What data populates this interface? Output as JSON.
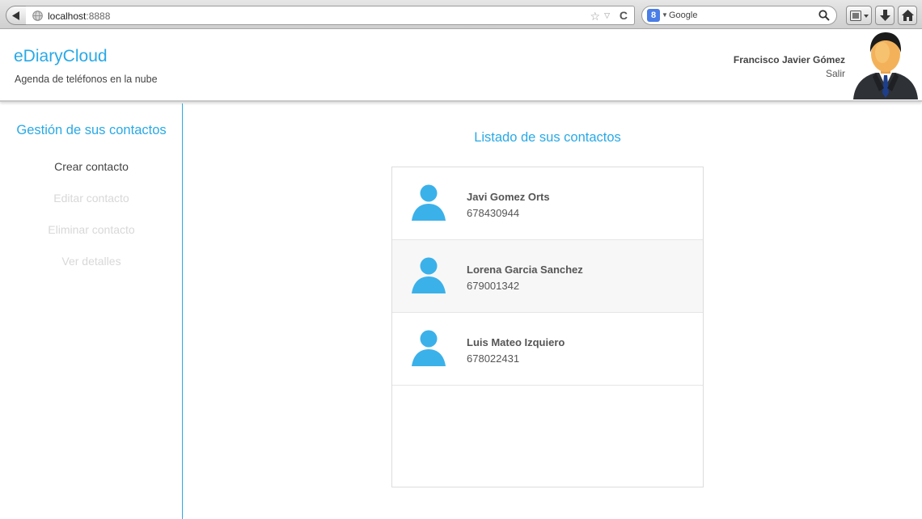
{
  "browser": {
    "url_host": "localhost",
    "url_port": ":8888",
    "search_engine": "Google",
    "search_badge": "8"
  },
  "header": {
    "title": "eDiaryCloud",
    "subtitle": "Agenda de teléfonos en la nube",
    "user_name": "Francisco Javier Gómez",
    "logout_label": "Salir"
  },
  "sidebar": {
    "title": "Gestión de sus contactos",
    "items": [
      {
        "label": "Crear contacto",
        "enabled": true
      },
      {
        "label": "Editar contacto",
        "enabled": false
      },
      {
        "label": "Eliminar contacto",
        "enabled": false
      },
      {
        "label": "Ver detalles",
        "enabled": false
      }
    ]
  },
  "main": {
    "title": "Listado de sus contactos",
    "contacts": [
      {
        "name": "Javi Gomez Orts",
        "phone": "678430944"
      },
      {
        "name": "Lorena Garcia Sanchez",
        "phone": "679001342"
      },
      {
        "name": "Luis Mateo Izquiero",
        "phone": "678022431"
      }
    ]
  },
  "colors": {
    "accent": "#29a9e6",
    "text": "#444444",
    "disabled_text": "#d8d8d8",
    "row_alt": "#f7f7f7"
  },
  "icons": {
    "back": "back-arrow-icon",
    "globe": "globe-icon",
    "star": "bookmark-star-icon",
    "reload": "reload-icon",
    "search": "magnifier-icon",
    "downloads": "download-icon",
    "home": "home-icon",
    "user_avatar": "businessman-avatar-icon",
    "contact_avatar": "person-icon"
  }
}
